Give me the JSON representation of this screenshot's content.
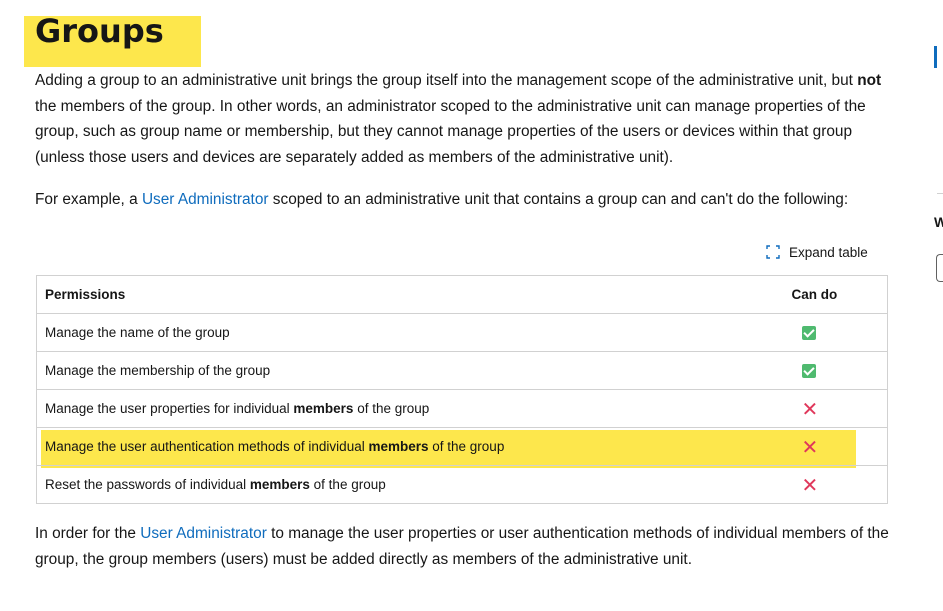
{
  "heading": "Groups",
  "intro": {
    "part1": "Adding a group to an administrative unit brings the group itself into the management scope of the administrative unit, but ",
    "bold": "not",
    "part2": " the members of the group. In other words, an administrator scoped to the administrative unit can manage properties of the group, such as group name or membership, but they cannot manage properties of the users or devices within that group (unless those users and devices are separately added as members of the administrative unit)."
  },
  "example": {
    "before": "For example, a ",
    "link": "User Administrator",
    "after": " scoped to an administrative unit that contains a group can and can't do the following:"
  },
  "expand_table_label": "Expand table",
  "table": {
    "headers": [
      "Permissions",
      "Can do"
    ],
    "rows": [
      {
        "pre": "Manage the name of the group",
        "bold": "",
        "post": "",
        "can_do": "yes"
      },
      {
        "pre": "Manage the membership of the group",
        "bold": "",
        "post": "",
        "can_do": "yes"
      },
      {
        "pre": "Manage the user properties for individual ",
        "bold": "members",
        "post": " of the group",
        "can_do": "no"
      },
      {
        "pre": "Manage the user authentication methods of individual ",
        "bold": "members",
        "post": " of the group",
        "can_do": "no"
      },
      {
        "pre": "Reset the passwords of individual ",
        "bold": "members",
        "post": " of the group",
        "can_do": "no"
      }
    ]
  },
  "footer": {
    "before": "In order for the ",
    "link": "User Administrator",
    "after": " to manage the user properties or user authentication methods of individual members of the group, the group members (users) must be added directly as members of the administrative unit."
  },
  "sidebar_fragment_text": "W",
  "colors": {
    "highlight": "#fde74c",
    "link": "#0f6cbd",
    "check": "#4fba6f",
    "cross": "#e0385b"
  },
  "icons": {
    "yes": "check-mark-icon",
    "no": "cross-mark-icon",
    "expand": "expand-table-icon"
  }
}
